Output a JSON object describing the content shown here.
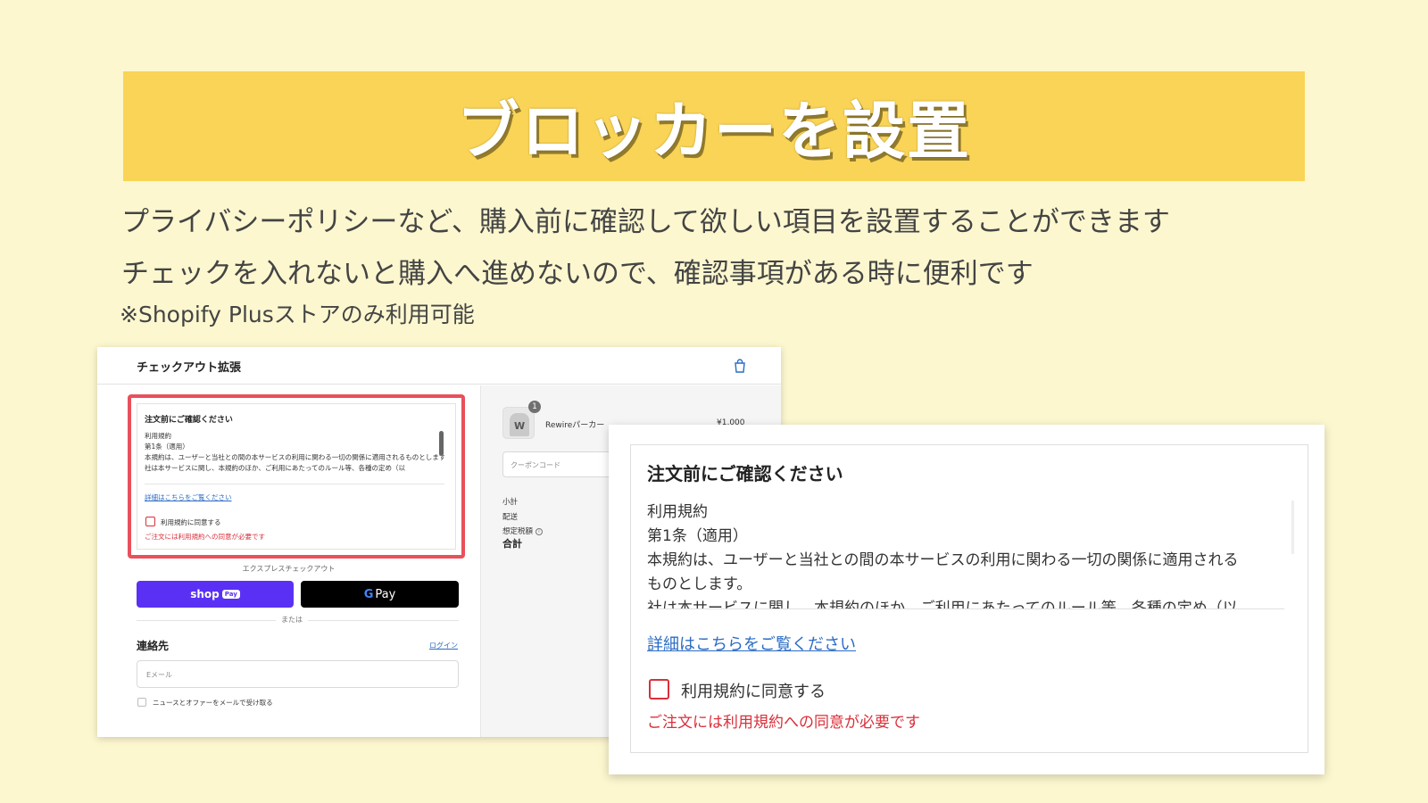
{
  "slide": {
    "title": "ブロッカーを設置",
    "description_line1": "プライバシーポリシーなど、購入前に確認して欲しい項目を設置することができます",
    "description_line2": "チェックを入れないと購入へ進めないので、確認事項がある時に便利です",
    "note": "※Shopify Plusストアのみ利用可能"
  },
  "checkout": {
    "header_title": "チェックアウト拡張",
    "bag_icon": "shopping-bag-icon",
    "blocker": {
      "title": "注文前にご確認ください",
      "body_lines": [
        "利用規約",
        "第1条（適用）",
        "本規約は、ユーザーと当社との間の本サービスの利用に関わる一切の関係に適用されるものとします。",
        "社は本サービスに関し、本規約のほか、ご利用にあたってのルール等、各種の定め（以"
      ],
      "link": "詳細はこちらをご覧ください",
      "checkbox_label": "利用規約に同意する",
      "error": "ご注文には利用規約への同意が必要です"
    },
    "express_label": "エクスプレスチェックアウト",
    "shop_pay_label": "shop",
    "shop_pay_chip": "Pay",
    "gpay_g": "G",
    "gpay_label": "Pay",
    "or_text": "または",
    "contact_title": "連絡先",
    "login_link": "ログイン",
    "email_placeholder": "Eメール",
    "newsletter_label": "ニュースとオファーをメールで受け取る",
    "summary": {
      "product_name": "Rewireパーカー",
      "product_price": "¥1,000",
      "quantity": "1",
      "coupon_placeholder": "クーポンコード",
      "subtotal_label": "小計",
      "shipping_label": "配送",
      "tax_label": "想定税額",
      "info_icon": "i",
      "total_label": "合計"
    }
  },
  "zoomed": {
    "title": "注文前にご確認ください",
    "body_lines": [
      "利用規約",
      "第1条（適用）",
      "本規約は、ユーザーと当社との間の本サービスの利用に関わる一切の関係に適用される",
      "ものとします。",
      "社は本サービスに関し、本規約のほか、ご利用にあたってのルール等、各種の定め（以"
    ],
    "link": "詳細はこちらをご覧ください",
    "checkbox_label": "利用規約に同意する",
    "error": "ご注文には利用規約への同意が必要です"
  },
  "colors": {
    "background": "#fcf7cf",
    "banner": "#fad456",
    "error_red": "#d9303b",
    "highlight_border": "#e8505b",
    "shop_pay_purple": "#5a31f4",
    "link_blue": "#2b6cc4"
  }
}
